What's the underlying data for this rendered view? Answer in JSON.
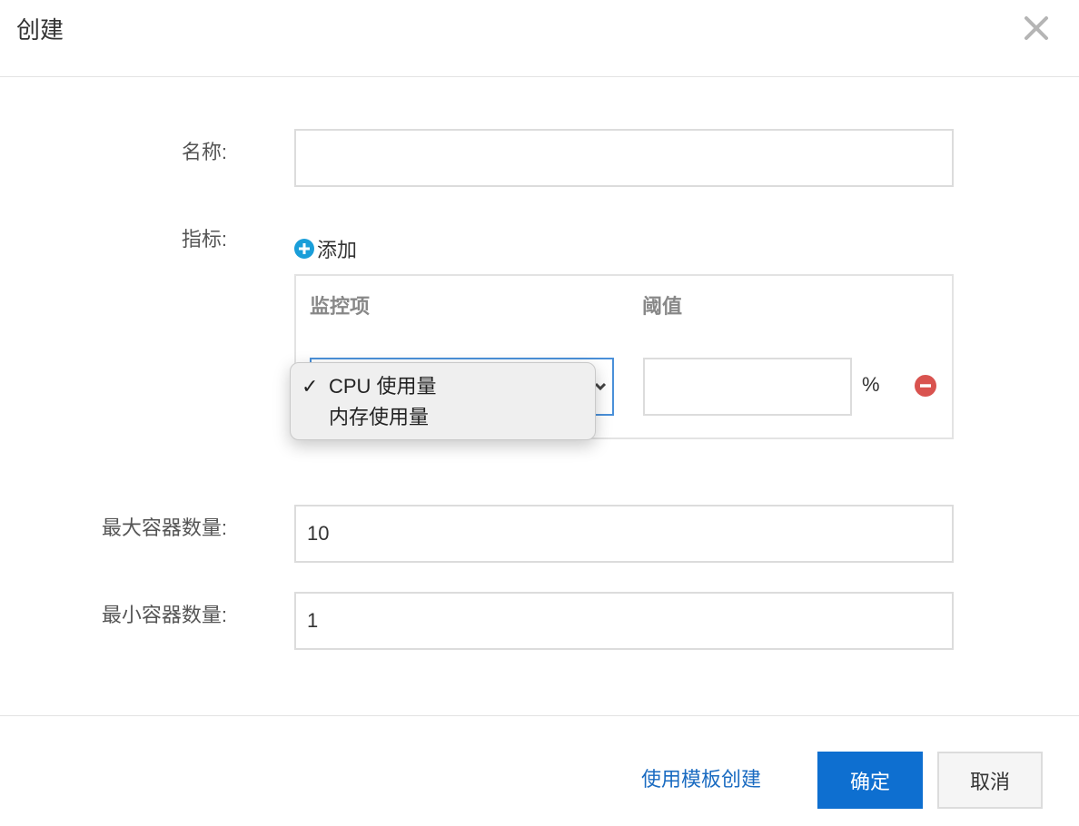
{
  "dialog": {
    "title": "创建",
    "close_icon": "close-icon"
  },
  "form": {
    "name_label": "名称:",
    "name_value": "",
    "metrics_label": "指标:",
    "add_label": "添加",
    "add_icon": "plus-circle-icon",
    "columns": {
      "monitor": "监控项",
      "threshold": "阈值"
    },
    "metric_row": {
      "threshold_value": "",
      "unit": "%",
      "remove_icon": "minus-circle-icon"
    },
    "dropdown": {
      "options": [
        {
          "label": "CPU 使用量",
          "selected": true,
          "check": "✓"
        },
        {
          "label": "内存使用量",
          "selected": false,
          "check": ""
        }
      ]
    },
    "max_label": "最大容器数量:",
    "max_value": "10",
    "min_label": "最小容器数量:",
    "min_value": "1"
  },
  "footer": {
    "template_link": "使用模板创建",
    "confirm_label": "确定",
    "cancel_label": "取消"
  },
  "colors": {
    "primary": "#0e6fd0",
    "link": "#1a6bc1",
    "add_icon": "#1a9ed9",
    "remove_icon": "#d9534f"
  }
}
